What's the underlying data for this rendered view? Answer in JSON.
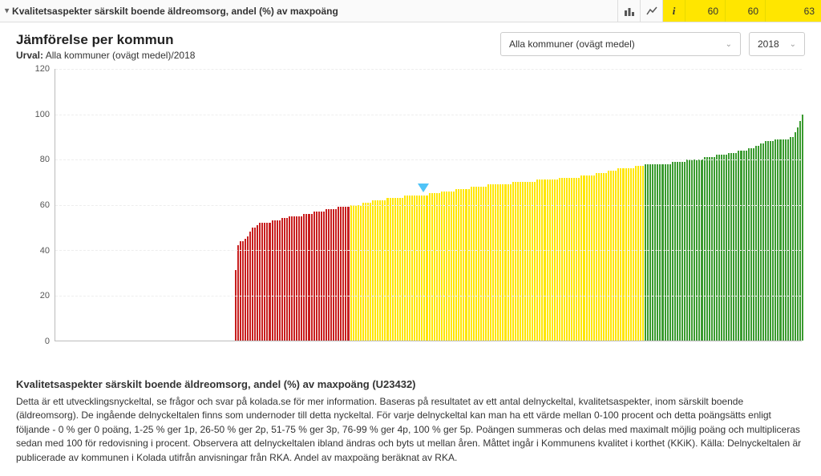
{
  "topbar": {
    "title": "Kvalitetsaspekter särskilt boende äldreomsorg, andel (%) av maxpoäng",
    "metrics": [
      "60",
      "60",
      "63"
    ]
  },
  "header": {
    "title": "Jämförelse per kommun",
    "urval_label": "Urval:",
    "urval_value": "Alla kommuner (ovägt medel)/2018"
  },
  "controls": {
    "dropdown": "Alla kommuner (ovägt medel)",
    "year": "2018"
  },
  "chart_data": {
    "type": "bar",
    "title": "Jämförelse per kommun",
    "xlabel": "",
    "ylabel": "",
    "ylim": [
      0,
      120
    ],
    "yticks": [
      0,
      20,
      40,
      60,
      80,
      100,
      120
    ],
    "left_blank_fraction": 0.24,
    "marker_value": 65,
    "marker_index_fraction": 0.33,
    "series": [
      {
        "name": "Röd",
        "color": "#c81e1e",
        "values": [
          31,
          42,
          44,
          44,
          45,
          46,
          48,
          50,
          50,
          51,
          52,
          52,
          52,
          52,
          52,
          53,
          53,
          53,
          53,
          54,
          54,
          54,
          55,
          55,
          55,
          55,
          55,
          55,
          56,
          56,
          56,
          56,
          57,
          57,
          57,
          57,
          57,
          58,
          58,
          58,
          58,
          58,
          59,
          59,
          59,
          59,
          59
        ]
      },
      {
        "name": "Gul",
        "color": "#ffe600",
        "values": [
          60,
          60,
          60,
          60,
          60,
          61,
          61,
          61,
          61,
          62,
          62,
          62,
          62,
          62,
          62,
          63,
          63,
          63,
          63,
          63,
          63,
          63,
          64,
          64,
          64,
          64,
          64,
          64,
          64,
          64,
          64,
          64,
          65,
          65,
          65,
          65,
          65,
          66,
          66,
          66,
          66,
          66,
          66,
          67,
          67,
          67,
          67,
          67,
          67,
          68,
          68,
          68,
          68,
          68,
          68,
          68,
          69,
          69,
          69,
          69,
          69,
          69,
          69,
          69,
          69,
          69,
          70,
          70,
          70,
          70,
          70,
          70,
          70,
          70,
          70,
          70,
          71,
          71,
          71,
          71,
          71,
          71,
          71,
          71,
          71,
          72,
          72,
          72,
          72,
          72,
          72,
          72,
          72,
          72,
          73,
          73,
          73,
          73,
          73,
          73,
          74,
          74,
          74,
          74,
          74,
          75,
          75,
          75,
          75,
          76,
          76,
          76,
          76,
          76,
          76,
          76,
          77,
          77,
          77,
          77
        ]
      },
      {
        "name": "Grön",
        "color": "#3a9b2f",
        "values": [
          78,
          78,
          78,
          78,
          78,
          78,
          78,
          78,
          78,
          78,
          78,
          79,
          79,
          79,
          79,
          79,
          79,
          80,
          80,
          80,
          80,
          80,
          80,
          80,
          81,
          81,
          81,
          81,
          81,
          82,
          82,
          82,
          82,
          82,
          83,
          83,
          83,
          83,
          84,
          84,
          84,
          84,
          85,
          85,
          85,
          86,
          86,
          87,
          87,
          88,
          88,
          88,
          88,
          89,
          89,
          89,
          89,
          89,
          89,
          90,
          90,
          92,
          94,
          97,
          100
        ]
      }
    ]
  },
  "description": {
    "heading": "Kvalitetsaspekter särskilt boende äldreomsorg, andel (%) av maxpoäng (U23432)",
    "body": "Detta är ett utvecklingsnyckeltal, se frågor och svar på kolada.se för mer information. Baseras på resultatet av ett antal delnyckeltal, kvalitetsaspekter, inom särskilt boende (äldreomsorg). De ingående delnyckeltalen finns som undernoder till detta nyckeltal. För varje delnyckeltal kan man ha ett värde mellan 0-100 procent och detta poängsätts enligt följande - 0 % ger 0 poäng, 1-25 % ger 1p, 26-50 % ger 2p, 51-75 % ger 3p, 76-99 % ger 4p, 100 % ger 5p. Poängen summeras och delas med maximalt möjlig poäng och multipliceras sedan med 100 för redovisning i procent. Observera att delnyckeltalen ibland ändras och byts ut mellan åren. Måttet ingår i Kommunens kvalitet i korthet (KKiK). Källa: Delnyckeltalen är publicerade av kommunen i Kolada utifrån anvisningar från RKA. Andel av maxpoäng beräknat av RKA."
  }
}
